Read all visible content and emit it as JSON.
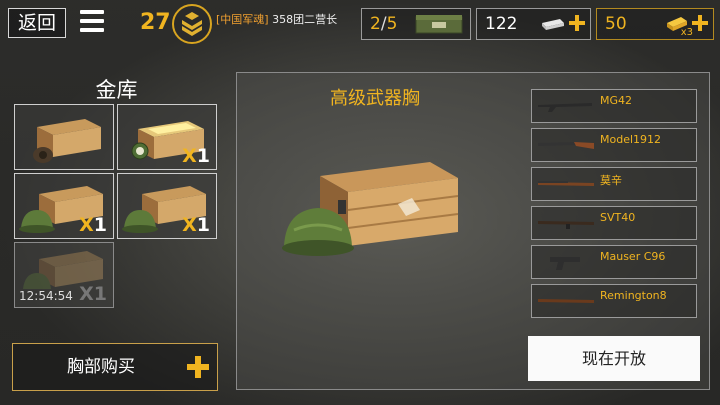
{
  "topbar": {
    "back_label": "返回",
    "level": "27",
    "player_tag": "[中国军魂]",
    "player_unit": "358团二营长",
    "crates": {
      "current": "2",
      "max": "5"
    },
    "cash": "122",
    "gold": "50",
    "gold_bonus": "x3"
  },
  "vault": {
    "title": "金库",
    "slots": [
      {
        "qty_prefix": "",
        "qty": "",
        "timer": ""
      },
      {
        "qty_prefix": "X",
        "qty": "1",
        "timer": ""
      },
      {
        "qty_prefix": "X",
        "qty": "1",
        "timer": ""
      },
      {
        "qty_prefix": "X",
        "qty": "1",
        "timer": ""
      },
      {
        "qty_prefix": "X",
        "qty": "1",
        "timer": "12:54:54"
      }
    ],
    "buy_label": "胸部购买"
  },
  "chest": {
    "title": "高级武器胸",
    "open_label": "现在开放"
  },
  "weapons": [
    "MG42",
    "Model1912",
    "莫辛",
    "SVT40",
    "Mauser C96",
    "Remington8"
  ],
  "colors": {
    "accent": "#f0b420",
    "panel_border": "#9a9a9a"
  }
}
